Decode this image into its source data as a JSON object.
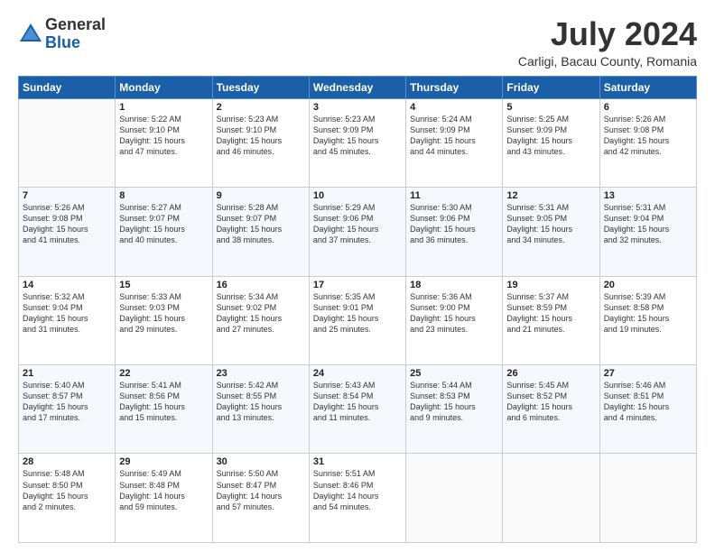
{
  "header": {
    "logo_general": "General",
    "logo_blue": "Blue",
    "main_title": "July 2024",
    "subtitle": "Carligi, Bacau County, Romania"
  },
  "weekdays": [
    "Sunday",
    "Monday",
    "Tuesday",
    "Wednesday",
    "Thursday",
    "Friday",
    "Saturday"
  ],
  "weeks": [
    [
      {
        "day": "",
        "info": ""
      },
      {
        "day": "1",
        "info": "Sunrise: 5:22 AM\nSunset: 9:10 PM\nDaylight: 15 hours\nand 47 minutes."
      },
      {
        "day": "2",
        "info": "Sunrise: 5:23 AM\nSunset: 9:10 PM\nDaylight: 15 hours\nand 46 minutes."
      },
      {
        "day": "3",
        "info": "Sunrise: 5:23 AM\nSunset: 9:09 PM\nDaylight: 15 hours\nand 45 minutes."
      },
      {
        "day": "4",
        "info": "Sunrise: 5:24 AM\nSunset: 9:09 PM\nDaylight: 15 hours\nand 44 minutes."
      },
      {
        "day": "5",
        "info": "Sunrise: 5:25 AM\nSunset: 9:09 PM\nDaylight: 15 hours\nand 43 minutes."
      },
      {
        "day": "6",
        "info": "Sunrise: 5:26 AM\nSunset: 9:08 PM\nDaylight: 15 hours\nand 42 minutes."
      }
    ],
    [
      {
        "day": "7",
        "info": "Sunrise: 5:26 AM\nSunset: 9:08 PM\nDaylight: 15 hours\nand 41 minutes."
      },
      {
        "day": "8",
        "info": "Sunrise: 5:27 AM\nSunset: 9:07 PM\nDaylight: 15 hours\nand 40 minutes."
      },
      {
        "day": "9",
        "info": "Sunrise: 5:28 AM\nSunset: 9:07 PM\nDaylight: 15 hours\nand 38 minutes."
      },
      {
        "day": "10",
        "info": "Sunrise: 5:29 AM\nSunset: 9:06 PM\nDaylight: 15 hours\nand 37 minutes."
      },
      {
        "day": "11",
        "info": "Sunrise: 5:30 AM\nSunset: 9:06 PM\nDaylight: 15 hours\nand 36 minutes."
      },
      {
        "day": "12",
        "info": "Sunrise: 5:31 AM\nSunset: 9:05 PM\nDaylight: 15 hours\nand 34 minutes."
      },
      {
        "day": "13",
        "info": "Sunrise: 5:31 AM\nSunset: 9:04 PM\nDaylight: 15 hours\nand 32 minutes."
      }
    ],
    [
      {
        "day": "14",
        "info": "Sunrise: 5:32 AM\nSunset: 9:04 PM\nDaylight: 15 hours\nand 31 minutes."
      },
      {
        "day": "15",
        "info": "Sunrise: 5:33 AM\nSunset: 9:03 PM\nDaylight: 15 hours\nand 29 minutes."
      },
      {
        "day": "16",
        "info": "Sunrise: 5:34 AM\nSunset: 9:02 PM\nDaylight: 15 hours\nand 27 minutes."
      },
      {
        "day": "17",
        "info": "Sunrise: 5:35 AM\nSunset: 9:01 PM\nDaylight: 15 hours\nand 25 minutes."
      },
      {
        "day": "18",
        "info": "Sunrise: 5:36 AM\nSunset: 9:00 PM\nDaylight: 15 hours\nand 23 minutes."
      },
      {
        "day": "19",
        "info": "Sunrise: 5:37 AM\nSunset: 8:59 PM\nDaylight: 15 hours\nand 21 minutes."
      },
      {
        "day": "20",
        "info": "Sunrise: 5:39 AM\nSunset: 8:58 PM\nDaylight: 15 hours\nand 19 minutes."
      }
    ],
    [
      {
        "day": "21",
        "info": "Sunrise: 5:40 AM\nSunset: 8:57 PM\nDaylight: 15 hours\nand 17 minutes."
      },
      {
        "day": "22",
        "info": "Sunrise: 5:41 AM\nSunset: 8:56 PM\nDaylight: 15 hours\nand 15 minutes."
      },
      {
        "day": "23",
        "info": "Sunrise: 5:42 AM\nSunset: 8:55 PM\nDaylight: 15 hours\nand 13 minutes."
      },
      {
        "day": "24",
        "info": "Sunrise: 5:43 AM\nSunset: 8:54 PM\nDaylight: 15 hours\nand 11 minutes."
      },
      {
        "day": "25",
        "info": "Sunrise: 5:44 AM\nSunset: 8:53 PM\nDaylight: 15 hours\nand 9 minutes."
      },
      {
        "day": "26",
        "info": "Sunrise: 5:45 AM\nSunset: 8:52 PM\nDaylight: 15 hours\nand 6 minutes."
      },
      {
        "day": "27",
        "info": "Sunrise: 5:46 AM\nSunset: 8:51 PM\nDaylight: 15 hours\nand 4 minutes."
      }
    ],
    [
      {
        "day": "28",
        "info": "Sunrise: 5:48 AM\nSunset: 8:50 PM\nDaylight: 15 hours\nand 2 minutes."
      },
      {
        "day": "29",
        "info": "Sunrise: 5:49 AM\nSunset: 8:48 PM\nDaylight: 14 hours\nand 59 minutes."
      },
      {
        "day": "30",
        "info": "Sunrise: 5:50 AM\nSunset: 8:47 PM\nDaylight: 14 hours\nand 57 minutes."
      },
      {
        "day": "31",
        "info": "Sunrise: 5:51 AM\nSunset: 8:46 PM\nDaylight: 14 hours\nand 54 minutes."
      },
      {
        "day": "",
        "info": ""
      },
      {
        "day": "",
        "info": ""
      },
      {
        "day": "",
        "info": ""
      }
    ]
  ]
}
